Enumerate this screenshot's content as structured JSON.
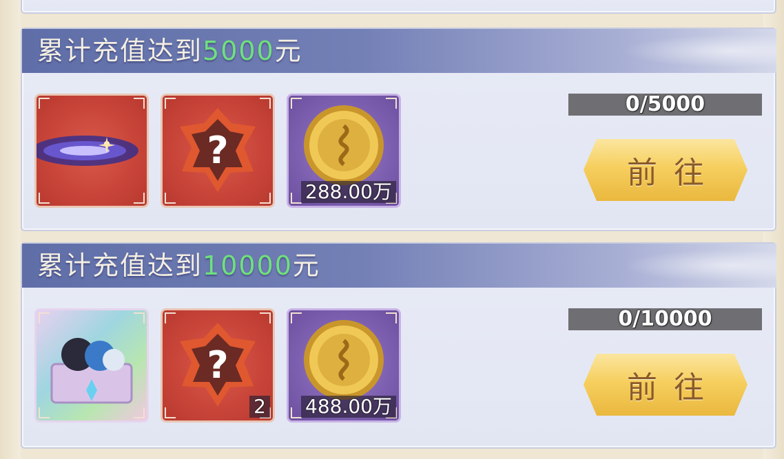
{
  "rewards": [
    {
      "title_prefix": "累计充值达到",
      "amount": "5000",
      "title_suffix": "元",
      "progress": "0/5000",
      "button_label": "前往",
      "items": [
        {
          "icon": "galaxy-swirl-icon",
          "quantity": ""
        },
        {
          "icon": "mystery-crystal-icon",
          "quantity": ""
        },
        {
          "icon": "gold-coin-icon",
          "quantity": "288.00万"
        }
      ]
    },
    {
      "title_prefix": "累计充值达到",
      "amount": "10000",
      "title_suffix": "元",
      "progress": "0/10000",
      "button_label": "前往",
      "items": [
        {
          "icon": "treasure-chest-icon",
          "quantity": ""
        },
        {
          "icon": "mystery-crystal-icon",
          "quantity": "2"
        },
        {
          "icon": "gold-coin-icon",
          "quantity": "488.00万"
        }
      ]
    }
  ],
  "colors": {
    "amount": "#6fe07d",
    "banner": "#6b78b0",
    "button": "#f6cf5f"
  }
}
